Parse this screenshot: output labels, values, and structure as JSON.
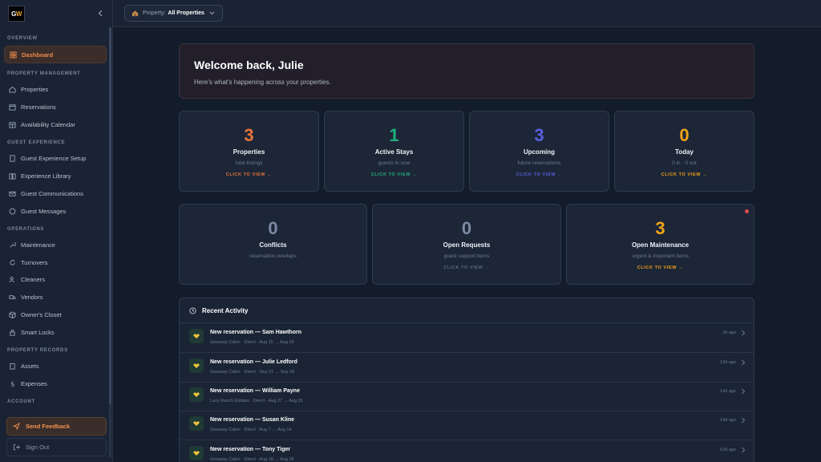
{
  "brand": {
    "logo_text": "GW"
  },
  "sidebar": {
    "sections": {
      "overview": "OVERVIEW",
      "property_management": "PROPERTY MANAGEMENT",
      "guest_experience": "GUEST EXPERIENCE",
      "operations": "OPERATIONS",
      "property_records": "PROPERTY RECORDS",
      "account": "ACCOUNT"
    },
    "items": {
      "dashboard": "Dashboard",
      "properties": "Properties",
      "reservations": "Reservations",
      "availability": "Availability Calendar",
      "guest_setup": "Guest Experience Setup",
      "experience_library": "Experience Library",
      "guest_comms": "Guest Communications",
      "guest_messages": "Guest Messages",
      "maintenance": "Maintenance",
      "turnovers": "Turnovers",
      "cleaners": "Cleaners",
      "vendors": "Vendors",
      "owners_closet": "Owner's Closet",
      "smart_locks": "Smart Locks",
      "assets": "Assets",
      "expenses": "Expenses"
    },
    "feedback": "Send Feedback",
    "signout": "Sign Out"
  },
  "topbar": {
    "property_label": "Property:",
    "property_value": "All Properties"
  },
  "welcome": {
    "title": "Welcome back, Julie",
    "subtitle": "Here's what's happening across your properties."
  },
  "stats": [
    {
      "value": "3",
      "label": "Properties",
      "sub": "total listings",
      "cta": "CLICK TO VIEW →",
      "color": "#e8733a"
    },
    {
      "value": "1",
      "label": "Active Stays",
      "sub": "guests in now",
      "cta": "CLICK TO VIEW →",
      "color": "#22b07d"
    },
    {
      "value": "3",
      "label": "Upcoming",
      "sub": "future reservations",
      "cta": "CLICK TO VIEW →",
      "color": "#5b5fe0"
    },
    {
      "value": "0",
      "label": "Today",
      "sub": "0 in · 0 out",
      "cta": "CLICK TO VIEW →",
      "color": "#f0a317"
    }
  ],
  "stats2": [
    {
      "value": "0",
      "label": "Conflicts",
      "sub": "reservation overlaps",
      "cta": "",
      "color": "#7d8aa3"
    },
    {
      "value": "0",
      "label": "Open Requests",
      "sub": "guest support items",
      "cta": "CLICK TO VIEW →",
      "color": "#7d8aa3",
      "cta_color": "#5f6b7e"
    },
    {
      "value": "3",
      "label": "Open Maintenance",
      "sub": "urgent & important items",
      "cta": "CLICK TO VIEW →",
      "color": "#f0a317"
    }
  ],
  "activity": {
    "title": "Recent Activity",
    "rows": [
      {
        "title": "New reservation — Sam Hawthorn",
        "meta": "Getaway Cabin  ·  Direct · Aug 15 → Aug 19",
        "ago": "3d ago"
      },
      {
        "title": "New reservation — Julie Ledford",
        "meta": "Getaway Cabin  ·  Direct · Sep 21 → Sep 28",
        "ago": "13d ago"
      },
      {
        "title": "New reservation — William Payne",
        "meta": "Lazy Ranch Estates  ·  Direct · Aug 27 → Aug 31",
        "ago": "14d ago"
      },
      {
        "title": "New reservation — Susan Kline",
        "meta": "Getaway Cabin  ·  Direct · Aug 7 → Aug 14",
        "ago": "14d ago"
      },
      {
        "title": "New reservation — Tony Tiger",
        "meta": "Getaway Cabin  ·  Direct · Aug 18 → Aug 28",
        "ago": "52d ago"
      }
    ]
  }
}
